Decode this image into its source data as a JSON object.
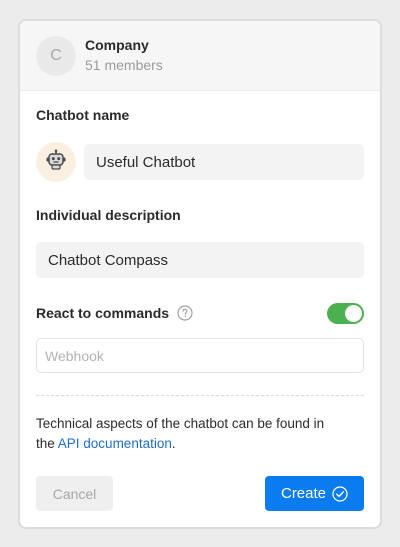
{
  "header": {
    "avatar_letter": "C",
    "company_name": "Company",
    "members": "51 members"
  },
  "form": {
    "chatbot_name_label": "Chatbot name",
    "chatbot_name_value": "Useful Chatbot",
    "bot_avatar_icon": "robot-icon",
    "description_label": "Individual description",
    "description_value": "Chatbot Compass",
    "react_label": "React to commands",
    "react_enabled": true,
    "toggle_color": "#4caf50",
    "webhook_placeholder": "Webhook",
    "webhook_value": ""
  },
  "info": {
    "text_before": "Technical aspects of the chatbot can be found in the ",
    "link_text": "API documentation",
    "text_after": "."
  },
  "actions": {
    "cancel_label": "Cancel",
    "create_label": "Create",
    "create_color": "#0a7cf0"
  }
}
